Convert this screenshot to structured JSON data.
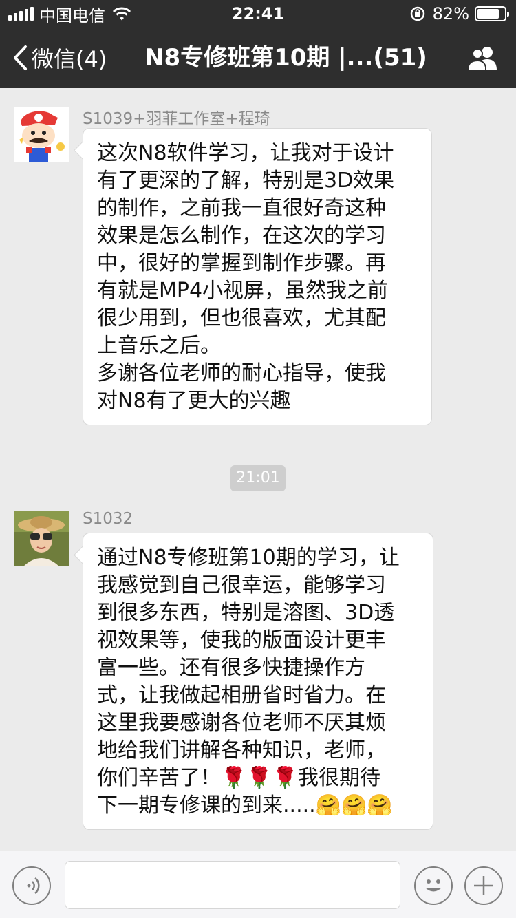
{
  "status_bar": {
    "carrier": "中国电信",
    "time": "22:41",
    "battery": "82%",
    "battery_level": 0.82
  },
  "nav": {
    "back_label": "微信(4)",
    "title": "N8专修班第10期 |...(51)"
  },
  "messages": [
    {
      "sender": "S1039+羽菲工作室+程琦",
      "text": "这次N8软件学习，让我对于设计\n有了更深的了解，特别是3D效果\n的制作，之前我一直很好奇这种\n效果是怎么制作，在这次的学习\n中，很好的掌握到制作步骤。再\n有就是MP4小视屏，虽然我之前\n很少用到，但也很喜欢，尤其配\n上音乐之后。\n多谢各位老师的耐心指导，使我\n对N8有了更大的兴趣"
    },
    {
      "sender": "S1032",
      "text": "通过N8专修班第10期的学习，让\n我感觉到自己很幸运，能够学习\n到很多东西，特别是溶图、3D透\n视效果等，使我的版面设计更丰\n富一些。还有很多快捷操作方\n式，让我做起相册省时省力。在\n这里我要感谢各位老师不厌其烦\n地给我们讲解各种知识，老师，\n你们辛苦了！🌹🌹🌹我很期待\n下一期专修课的到来.....🤗🤗🤗"
    }
  ],
  "timestamp": "21:01",
  "input": {
    "placeholder": ""
  }
}
